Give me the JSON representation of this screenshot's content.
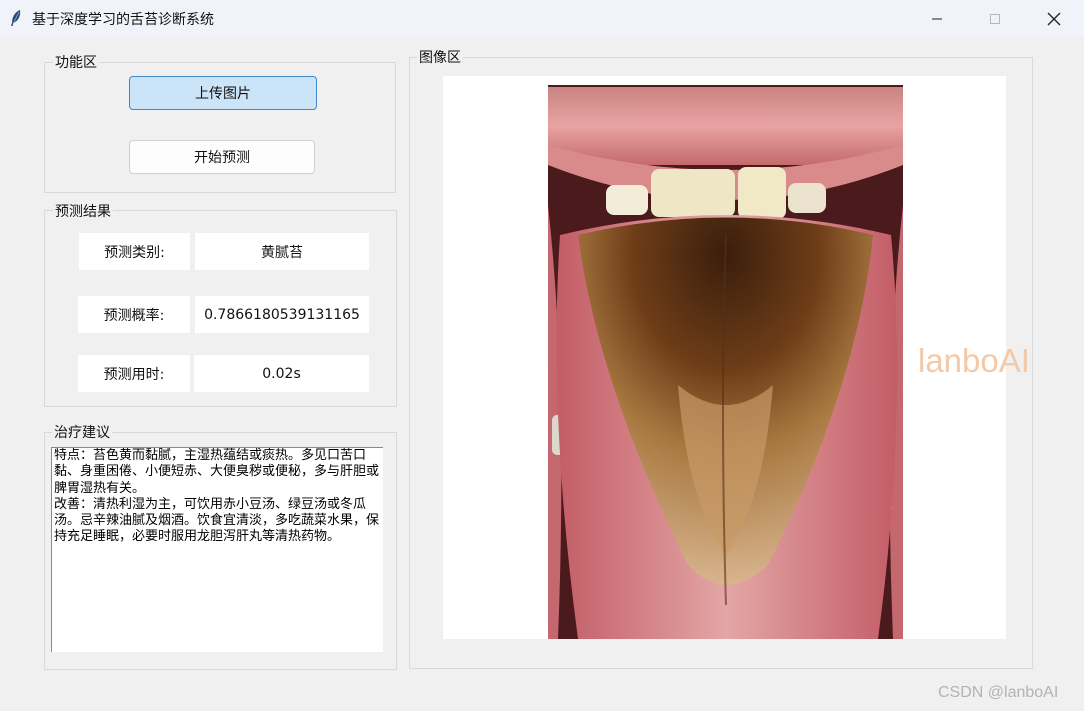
{
  "window": {
    "title": "基于深度学习的舌苔诊断系统",
    "icon": "feather-icon",
    "controls": [
      "minimize-icon",
      "maximize-icon",
      "close-icon"
    ]
  },
  "function_area": {
    "label": "功能区",
    "upload_button": "上传图片",
    "predict_button": "开始预测"
  },
  "results": {
    "label": "预测结果",
    "rows": [
      {
        "label": "预测类别:",
        "value": "黄腻苔"
      },
      {
        "label": "预测概率:",
        "value": "0.7866180539131165"
      },
      {
        "label": "预测用时:",
        "value": "0.02s"
      }
    ]
  },
  "advice": {
    "label": "治疗建议",
    "text": "特点：苔色黄而黏腻，主湿热蕴结或痰热。多见口苦口黏、身重困倦、小便短赤、大便臭秽或便秘，多与肝胆或脾胃湿热有关。\n改善：清热利湿为主，可饮用赤小豆汤、绿豆汤或冬瓜汤。忌辛辣油腻及烟酒。饮食宜清淡，多吃蔬菜水果，保持充足睡眠，必要时服用龙胆泻肝丸等清热药物。"
  },
  "image_area": {
    "label": "图像区",
    "watermark": "lanboAI"
  },
  "footer": {
    "text": "CSDN @lanboAI"
  },
  "colors": {
    "upload_button_bg": "#cce4f7",
    "upload_button_border": "#3f87c7",
    "watermark": "#f3c9a8"
  }
}
